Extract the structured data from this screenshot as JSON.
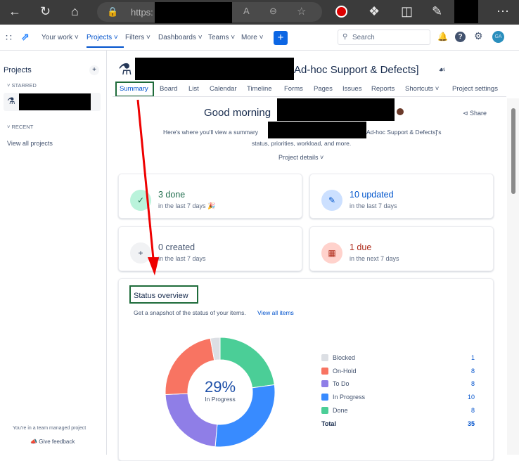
{
  "browser": {
    "url_prefix": "https:"
  },
  "topnav": {
    "items": [
      "Your work",
      "Projects",
      "Filters",
      "Dashboards",
      "Teams",
      "More"
    ],
    "create": "+",
    "search_placeholder": "Search",
    "avatar": "GA"
  },
  "sidebar": {
    "title": "Projects",
    "add": "+",
    "starred": "STARRED",
    "recent": "RECENT",
    "view_all": "View all projects",
    "footer": "You're in a team managed project",
    "feedback": "Give feedback"
  },
  "project": {
    "title_suffix": "Ad-hoc Support & Defects]"
  },
  "tabs": [
    "Summary",
    "Board",
    "List",
    "Calendar",
    "Timeline",
    "Forms",
    "Pages",
    "Issues",
    "Reports",
    "Shortcuts",
    "Project settings"
  ],
  "summary": {
    "greeting": "Good morning",
    "share": "Share",
    "desc1": "Here's where you'll view a summary",
    "desc1_suffix": "Ad-hoc Support & Defects]'s",
    "desc2": "status, priorities, workload, and more.",
    "project_details": "Project details"
  },
  "cards": [
    {
      "title": "3 done",
      "sub": "in the last 7 days 🎉",
      "color": "#216e4e",
      "bg": "#baf3db",
      "icon": "✓"
    },
    {
      "title": "10 updated",
      "sub": "in the last 7 days",
      "color": "#0055cc",
      "bg": "#cce0ff",
      "icon": "✎"
    },
    {
      "title": "0 created",
      "sub": "in the last 7 days",
      "color": "#44546f",
      "bg": "#f1f2f4",
      "icon": "+"
    },
    {
      "title": "1 due",
      "sub": "in the next 7 days",
      "color": "#ae2a19",
      "bg": "#ffd2cc",
      "icon": "▦"
    }
  ],
  "status": {
    "title": "Status overview",
    "sub": "Get a snapshot of the status of your items.",
    "link": "View all items",
    "center_pct": "29%",
    "center_label": "In Progress",
    "total_label": "Total",
    "total": "35"
  },
  "chart_data": {
    "type": "pie",
    "title": "Status overview",
    "categories": [
      "Blocked",
      "On-Hold",
      "To Do",
      "In Progress",
      "Done"
    ],
    "values": [
      1,
      8,
      8,
      10,
      8
    ],
    "colors": [
      "#dcdfe4",
      "#f87462",
      "#8f7ee7",
      "#388bff",
      "#4bce97"
    ],
    "total": 35
  }
}
